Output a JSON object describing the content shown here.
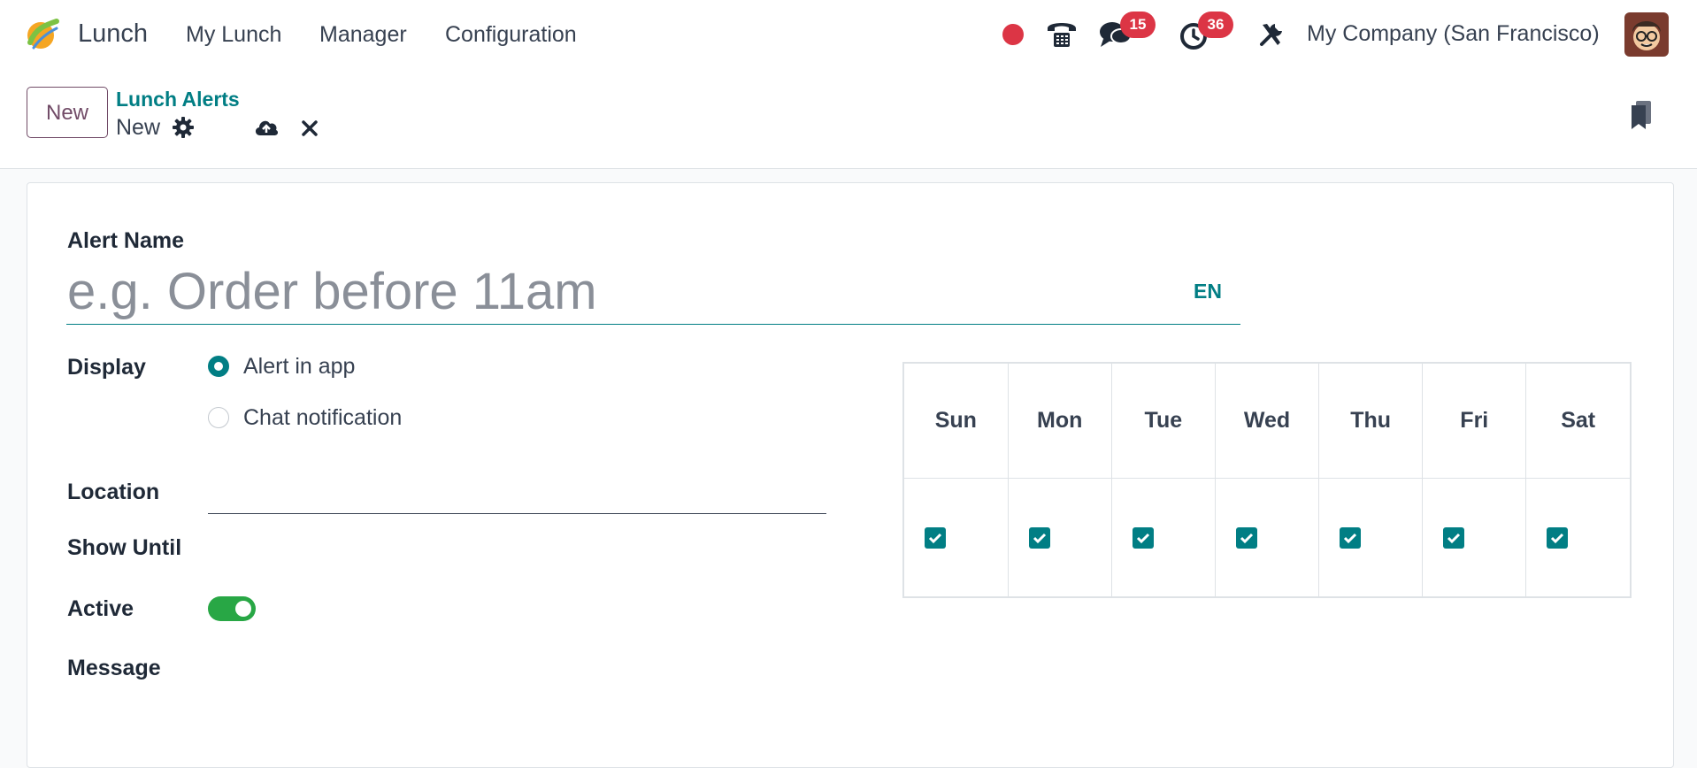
{
  "nav": {
    "app_name": "Lunch",
    "menu": [
      "My Lunch",
      "Manager",
      "Configuration"
    ],
    "messages_count": "15",
    "activities_count": "36",
    "company": "My Company (San Francisco)"
  },
  "control": {
    "new_label": "New",
    "breadcrumb_parent": "Lunch Alerts",
    "breadcrumb_current": "New"
  },
  "form": {
    "alert_name_label": "Alert Name",
    "alert_name_placeholder": "e.g. Order before 11am",
    "alert_name_value": "",
    "lang": "EN",
    "display_label": "Display",
    "display_options": [
      {
        "label": "Alert in app",
        "selected": true
      },
      {
        "label": "Chat notification",
        "selected": false
      }
    ],
    "location_label": "Location",
    "location_value": "",
    "show_until_label": "Show Until",
    "active_label": "Active",
    "active": true,
    "message_label": "Message"
  },
  "days": {
    "headers": [
      "Sun",
      "Mon",
      "Tue",
      "Wed",
      "Thu",
      "Fri",
      "Sat"
    ],
    "checked": [
      true,
      true,
      true,
      true,
      true,
      true,
      true
    ]
  },
  "colors": {
    "brand": "#714b67",
    "accent": "#017e84",
    "badge": "#dc3545",
    "toggle_on": "#28a745"
  }
}
